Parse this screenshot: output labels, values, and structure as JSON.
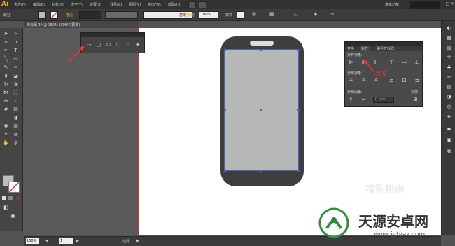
{
  "app": {
    "logo": "Ai"
  },
  "menu": {
    "items": [
      "文件(F)",
      "编辑(E)",
      "对象(O)",
      "文字(T)",
      "选择(S)",
      "效果(C)",
      "视图(V)",
      "窗口(W)",
      "帮助(H)"
    ],
    "workspace": "基本功能",
    "window_buttons": [
      "–",
      "□",
      "✕"
    ]
  },
  "control_bar": {
    "label_path": "路径",
    "stroke_label": "描边",
    "brush_label": "基本",
    "opacity_label": "不透明度",
    "opacity_value": "100%",
    "style_label": "样式"
  },
  "doc_tab": {
    "title": "未标题-1* @ 150% (CMYK/预览)"
  },
  "align_panel": {
    "tabs": [
      "变换",
      "对齐",
      "路径查找器"
    ],
    "section_align": "对齐对象:",
    "section_distribute": "分布对象:",
    "section_spacing": "分布间距:",
    "align_to_label": "对齐:",
    "spacing_value": "0 mm"
  },
  "annotation": {
    "text": "对齐"
  },
  "status_bar": {
    "zoom": "150%",
    "page": "1",
    "tool": "选择"
  },
  "watermark": {
    "faint_text": "搜狗指南",
    "title": "天源安卓网",
    "url": "www.jytyaz.com"
  },
  "colors": {
    "accent": "#3c63d8",
    "annotation": "#e33",
    "logo": "#f7a21b"
  }
}
